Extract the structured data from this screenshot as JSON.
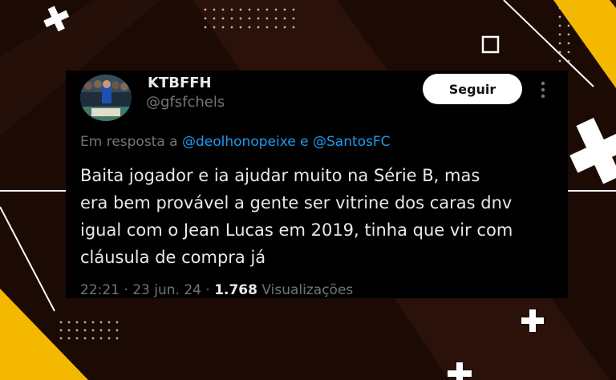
{
  "tweet": {
    "name": "KTBFFH",
    "handle": "@gfsfchels",
    "follow_label": "Seguir",
    "reply_prefix": "Em resposta a",
    "reply_user_1": "@deolhonopeixe",
    "reply_and": "e",
    "reply_user_2": "@SantosFC",
    "text_lines": [
      "Baita jogador e ia ajudar muito na Série B, mas",
      "era bem provável a gente ser vitrine dos caras dnv",
      "igual com o Jean Lucas em 2019, tinha que vir com",
      "cláusula de compra já"
    ],
    "time": "22:21",
    "separator": "·",
    "date": "23 jun. 24",
    "views_count": "1.768",
    "views_label": "Visualizações"
  },
  "icons": {
    "more": "more-vertical-icon",
    "square": "square-outline-icon",
    "plus": "plus-icon"
  },
  "colors": {
    "background": "#1c0a05",
    "accent_yellow": "#f5b800",
    "card": "#000000",
    "link": "#1d9bf0",
    "text_primary": "#e7e9ea",
    "text_secondary": "#71767b"
  }
}
